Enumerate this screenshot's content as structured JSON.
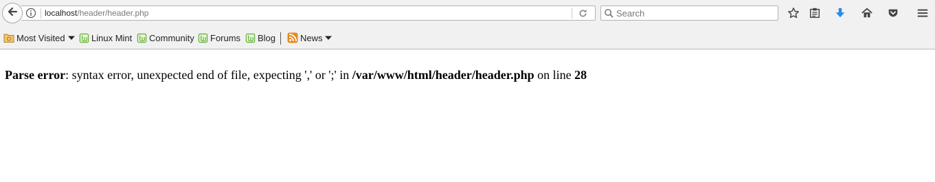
{
  "urlbar": {
    "host": "localhost",
    "path": "/header/header.php"
  },
  "search": {
    "placeholder": "Search"
  },
  "bookmarks": {
    "most_visited": "Most Visited",
    "linux_mint": "Linux Mint",
    "community": "Community",
    "forums": "Forums",
    "blog": "Blog",
    "news": "News"
  },
  "error": {
    "label": "Parse error",
    "message": ": syntax error, unexpected end of file, expecting ',' or ';' in ",
    "file": "/var/www/html/header/header.php",
    "on_line_text": " on line ",
    "line": "28"
  },
  "colors": {
    "accent_blue": "#2b8ae6",
    "mint_green": "#6cb33f",
    "rss_orange": "#e8891c"
  }
}
